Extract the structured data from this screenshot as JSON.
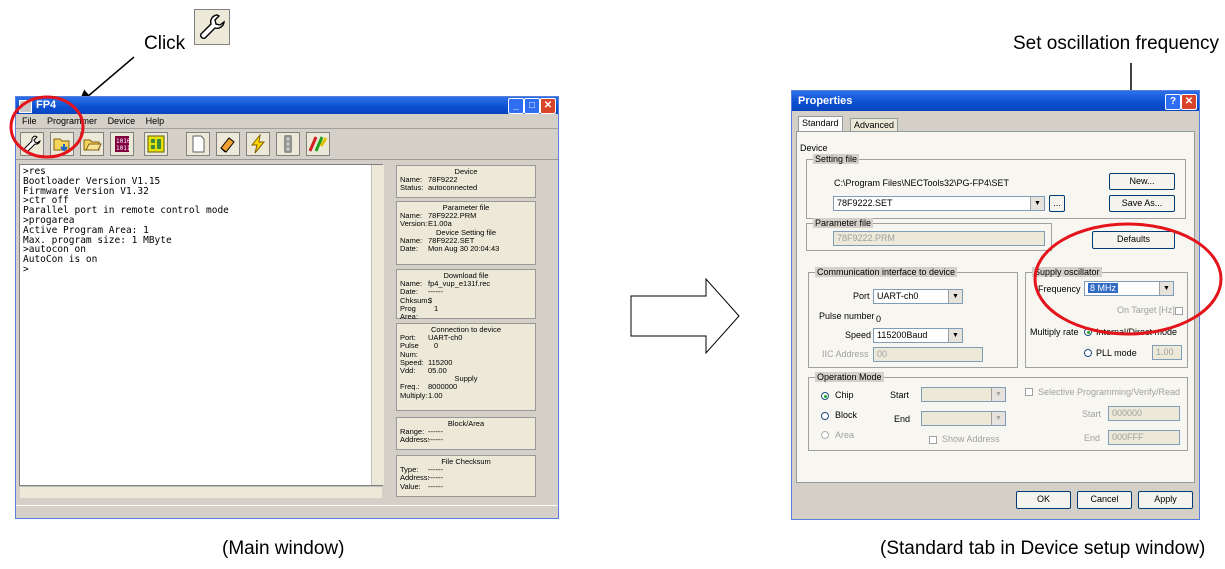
{
  "callouts": {
    "click": "Click",
    "set_frequency": "Set oscillation frequency"
  },
  "captions": {
    "main": "(Main window)",
    "setup": "(Standard tab in Device setup window)"
  },
  "colors": {
    "highlight_circle": "#e3141c",
    "xp_blue": "#0b4fd0"
  },
  "main_window": {
    "title": "FP4",
    "menu": [
      "File",
      "Programmer",
      "Device",
      "Help"
    ],
    "toolbar_icons": [
      "wrench-icon",
      "folder-arrow-icon",
      "open-folder-icon",
      "binary-1010-icon",
      "chip-layout-icon",
      "blank-page-icon",
      "erase-icon",
      "program-icon",
      "traffic-light-icon",
      "autoprocedure-icon"
    ],
    "console_lines": [
      ">res",
      "Bootloader Version V1.15",
      "Firmware Version V1.32",
      ">ctr off",
      "Parallel port in remote control mode",
      ">progarea",
      "Active Program Area: 1",
      "Max. program size: 1 MByte",
      ">autocon on",
      "AutoCon is on",
      ">"
    ],
    "info": {
      "device": {
        "header": "Device",
        "name_label": "Name:",
        "name": "78F9222",
        "status_label": "Status:",
        "status": "autoconnected"
      },
      "parameter_file": {
        "header": "Parameter file",
        "name_label": "Name:",
        "name": "78F9222.PRM",
        "version_label": "Version:",
        "version": "E1.00a",
        "setting_header": "Device Setting file",
        "setting_name": "78F9222.SET",
        "date_label": "Date:",
        "date": "Mon Aug 30 20:04:43"
      },
      "download": {
        "header": "Download file",
        "name_label": "Name:",
        "name": "fp4_vup_e131f.rec",
        "date_label": "Date:",
        "date": "------",
        "chksum_label": "Chksum:",
        "chksum": "$",
        "progarea_label": "Prog Area:",
        "progarea": "1"
      },
      "connection": {
        "header": "Connection to device",
        "port_label": "Port:",
        "port": "UART-ch0",
        "pulse_label": "Pulse Num:",
        "pulse": "0",
        "speed_label": "Speed:",
        "speed": "115200",
        "vdd_label": "Vdd:",
        "vdd": "05.00",
        "supply_header": "Supply",
        "freq_label": "Freq.:",
        "freq": "8000000",
        "multiply_label": "Multiply:",
        "multiply": "1.00"
      },
      "block": {
        "header": "Block/Area",
        "range_label": "Range:",
        "range": "------",
        "address_label": "Address:",
        "address": "------"
      },
      "checksum": {
        "header": "File Checksum",
        "type_label": "Type:",
        "type": "------",
        "address_label": "Address:",
        "address": "------",
        "value_label": "Value:",
        "value": "------"
      }
    }
  },
  "dialog": {
    "title": "Properties",
    "tabs": [
      "Standard",
      "Advanced"
    ],
    "device_group": "Device",
    "setting_file_label": "Setting file",
    "setting_path": "C:\\Program Files\\NECTools32\\PG-FP4\\SET",
    "setting_select": "78F9222.SET",
    "browse_button": "...",
    "new_button": "New...",
    "save_as_button": "Save As...",
    "parameter_file_label": "Parameter file",
    "parameter_file_value": "78F9222.PRM",
    "defaults_button": "Defaults",
    "comm_group": "Communication interface to device",
    "port_label": "Port",
    "port_value": "UART-ch0",
    "pulse_label": "Pulse number",
    "pulse_value": "0",
    "speed_label": "Speed",
    "speed_value": "115200Baud",
    "iic_label": "IIC Address",
    "iic_value": "00",
    "supply_group": "Supply oscillator",
    "frequency_label": "Frequency",
    "frequency_value": "8 MHz",
    "on_target_label": "On Target [Hz]",
    "multiply_label": "Multiply rate",
    "internal_label": "Internal/Direct mode",
    "pll_label": "PLL mode",
    "pll_value": "1.00",
    "opmode_group": "Operation Mode",
    "chip_label": "Chip",
    "block_label": "Block",
    "area_label": "Area",
    "start_label": "Start",
    "end_label": "End",
    "show_address_label": "Show Address",
    "selective_label": "Selective Programming/Verify/Read",
    "sel_start_label": "Start",
    "sel_start_value": "000000",
    "sel_end_label": "End",
    "sel_end_value": "000FFF",
    "ok_button": "OK",
    "cancel_button": "Cancel",
    "apply_button": "Apply"
  }
}
